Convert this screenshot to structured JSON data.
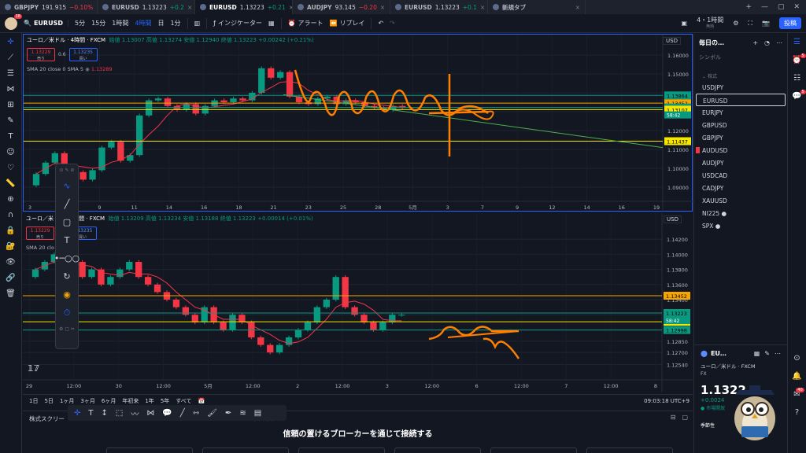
{
  "tabs": [
    {
      "name": "GBPJPY",
      "price": "191.915",
      "change": "−0.10%",
      "dir": "neg",
      "active": false
    },
    {
      "name": "EURUSD",
      "price": "1.13223",
      "change": "+0.2",
      "dir": "pos",
      "active": false
    },
    {
      "name": "EURUSD",
      "price": "1.13223",
      "change": "+0.21",
      "dir": "pos",
      "active": true
    },
    {
      "name": "AUDJPY",
      "price": "93.145",
      "change": "−0.20",
      "dir": "neg",
      "active": false
    },
    {
      "name": "EURUSD",
      "price": "1.13223",
      "change": "+0.1",
      "dir": "pos",
      "active": false
    },
    {
      "name": "新規タブ",
      "price": "",
      "change": "",
      "dir": "",
      "active": false
    }
  ],
  "toolbar": {
    "avatar_badge": "18",
    "symbol": "EURUSD",
    "timeframes": [
      "5分",
      "15分",
      "1時間",
      "4時間",
      "日",
      "1分"
    ],
    "selected_timeframe": "4時間",
    "indicators_label": "インジケーター",
    "alert_label": "アラート",
    "replay_label": "リプレイ",
    "layout_label": "4・1時間",
    "layout_sub": "無題",
    "publish_label": "投稿"
  },
  "pane1": {
    "title": "ユーロ／米ドル · 4時間 · FXCM",
    "ohlc": "始値 1.13007  高値 1.13274  安値 1.12940  終値 1.13223  +0.00242 (+0.21%)",
    "sell_price": "1.13229",
    "sell_label": "売り",
    "spread": "0.6",
    "buy_price": "1.13235",
    "buy_label": "買い",
    "sma": "SMA 20 close 0 SMA 5",
    "sma_value": "1.13289",
    "currency": "USD"
  },
  "pane2": {
    "title": "ユーロ／米ドル · 1時間 · FXCM",
    "ohlc": "始値 1.13209  高値 1.13234  安値 1.13188  終値 1.13223  +0.00014 (+0.01%)",
    "sell_price": "1.13229",
    "sell_label": "売り",
    "buy_price": "1.13235",
    "buy_label": "買い",
    "sma": "SMA 20 clo",
    "currency": "USD"
  },
  "chart_data": [
    {
      "type": "candlestick",
      "title": "ユーロ／米ドル · 4時間 · FXCM",
      "ylim": [
        1.085,
        1.165
      ],
      "yticks": [
        "1.16000",
        "1.15000",
        "1.14000",
        "1.13000",
        "1.12000",
        "1.11000",
        "1.10000",
        "1.09000"
      ],
      "xticks": [
        "3",
        "7",
        "9",
        "11",
        "14",
        "16",
        "18",
        "21",
        "23",
        "25",
        "28",
        "5月",
        "3",
        "7",
        "9",
        "12",
        "14",
        "16",
        "19"
      ],
      "close_series": [
        1.097,
        1.103,
        1.108,
        1.101,
        1.098,
        1.094,
        1.099,
        1.111,
        1.114,
        1.104,
        1.107,
        1.128,
        1.136,
        1.137,
        1.133,
        1.131,
        1.134,
        1.129,
        1.133,
        1.136,
        1.135,
        1.137,
        1.136,
        1.14,
        1.153,
        1.148,
        1.151,
        1.138,
        1.135,
        1.134,
        1.137,
        1.138,
        1.134,
        1.136,
        1.135,
        1.133,
        1.132,
        1.131,
        1.133,
        1.132
      ],
      "horizontal_lines": [
        {
          "value": 1.13452,
          "label": "1.13452",
          "color": "#f7a600"
        },
        {
          "value": 1.13223,
          "label": "1.13223",
          "color": "#089981"
        },
        {
          "value": 1.13107,
          "label": "1.13107",
          "color": "#f7e600"
        },
        {
          "value": 1.11437,
          "label": "1.11437",
          "color": "#f7e600"
        },
        {
          "value": 1.13864,
          "label": "1.13864",
          "color": "#089981"
        }
      ],
      "countdown": "58:42"
    },
    {
      "type": "candlestick",
      "title": "ユーロ／米ドル · 1時間 · FXCM",
      "ylim": [
        1.124,
        1.144
      ],
      "yticks": [
        "1.14200",
        "1.14000",
        "1.13800",
        "1.13600",
        "1.13400",
        "1.13200",
        "1.13000",
        "1.12850",
        "1.12700",
        "1.12540"
      ],
      "xticks": [
        "29",
        "12:00",
        "30",
        "12:00",
        "5月",
        "12:00",
        "2",
        "12:00",
        "3",
        "12:00",
        "6",
        "12:00",
        "7",
        "12:00",
        "8"
      ],
      "close_series": [
        1.138,
        1.139,
        1.14,
        1.138,
        1.139,
        1.137,
        1.138,
        1.136,
        1.137,
        1.138,
        1.139,
        1.137,
        1.136,
        1.135,
        1.134,
        1.133,
        1.132,
        1.131,
        1.133,
        1.131,
        1.13,
        1.132,
        1.131,
        1.129,
        1.128,
        1.127,
        1.128,
        1.129,
        1.13,
        1.131,
        1.133,
        1.134,
        1.137,
        1.133,
        1.132,
        1.131,
        1.13,
        1.131,
        1.132,
        1.132
      ],
      "horizontal_lines": [
        {
          "value": 1.13452,
          "label": "1.13452",
          "color": "#f7a600"
        },
        {
          "value": 1.13223,
          "label": "1.13223",
          "color": "#089981"
        },
        {
          "value": 1.13107,
          "label": "1.13107",
          "color": "#f7e600"
        },
        {
          "value": 1.12998,
          "label": "1.12998",
          "color": "#089981"
        }
      ],
      "countdown": "58:42"
    }
  ],
  "timeframes_bar": {
    "ranges": [
      "1日",
      "5日",
      "1ヶ月",
      "3ヶ月",
      "6ヶ月",
      "年初来",
      "1年",
      "5年",
      "すべて"
    ],
    "clock": "09:03:18 UTC+9"
  },
  "trading_panel": {
    "tabs": [
      "株式スクリー",
      "レードパネル"
    ],
    "message": "信頼の置けるブローカーを通じて接続する"
  },
  "watchlist": {
    "title": "毎日の…",
    "column": "シンボル",
    "section": "株式",
    "items": [
      "USDJPY",
      "EURUSD",
      "EURJPY",
      "GBPUSD",
      "GBPJPY",
      "AUDUSD",
      "AUDJPY",
      "USDCAD",
      "CADJPY",
      "XAUUSD",
      "NI225 ●",
      "SPX ●"
    ],
    "selected": "EURUSD",
    "flagged": "AUDUSD"
  },
  "details": {
    "symbol": "EU…",
    "name": "ユーロ／米ドル · FXCM",
    "type": "FX",
    "price": "1.1322",
    "change": "+0.0024",
    "status": "● 市場開放",
    "seasonality": "季節性"
  },
  "rightstrip": {
    "badge1": "5",
    "badge2": "5",
    "badge3": "40"
  },
  "colors": {
    "up": "#089981",
    "down": "#f23645",
    "sma": "#f23645",
    "annotation": "#ff7f00",
    "accent": "#2962ff",
    "trendline": "#4caf50"
  }
}
